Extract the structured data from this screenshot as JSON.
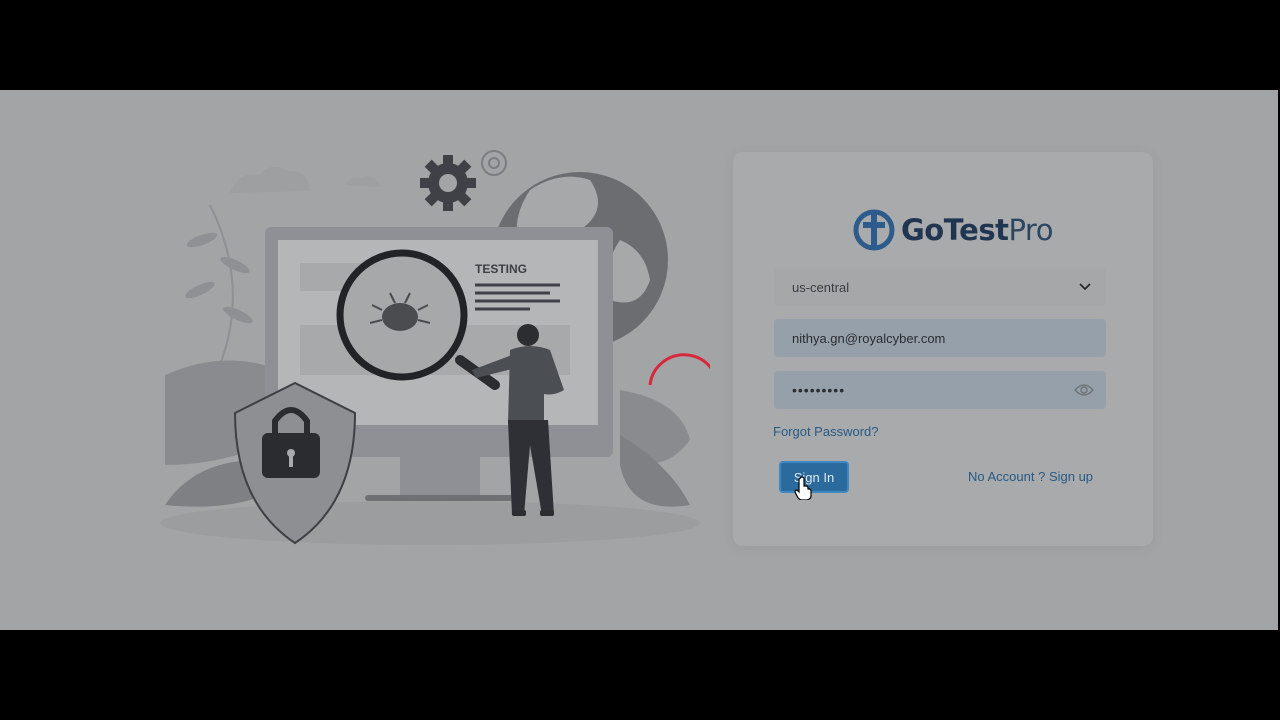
{
  "brand": {
    "name_bold": "GoTest",
    "name_light": "Pro"
  },
  "illustration": {
    "label": "TESTING"
  },
  "form": {
    "region_value": "us-central",
    "email_value": "nithya.gn@royalcyber.com",
    "password_masked": "•••••••••",
    "forgot_label": "Forgot Password?",
    "signin_label": "Sign In",
    "signup_label": "No Account ? Sign up"
  },
  "icons": {
    "region": "chevron-down-icon",
    "password": "eye-icon",
    "logo": "gotestpro-logo-icon",
    "cursor": "hand-pointer-icon"
  },
  "colors": {
    "link": "#275a85",
    "button": "#2a6a9c",
    "spinner": "#d8283b"
  }
}
